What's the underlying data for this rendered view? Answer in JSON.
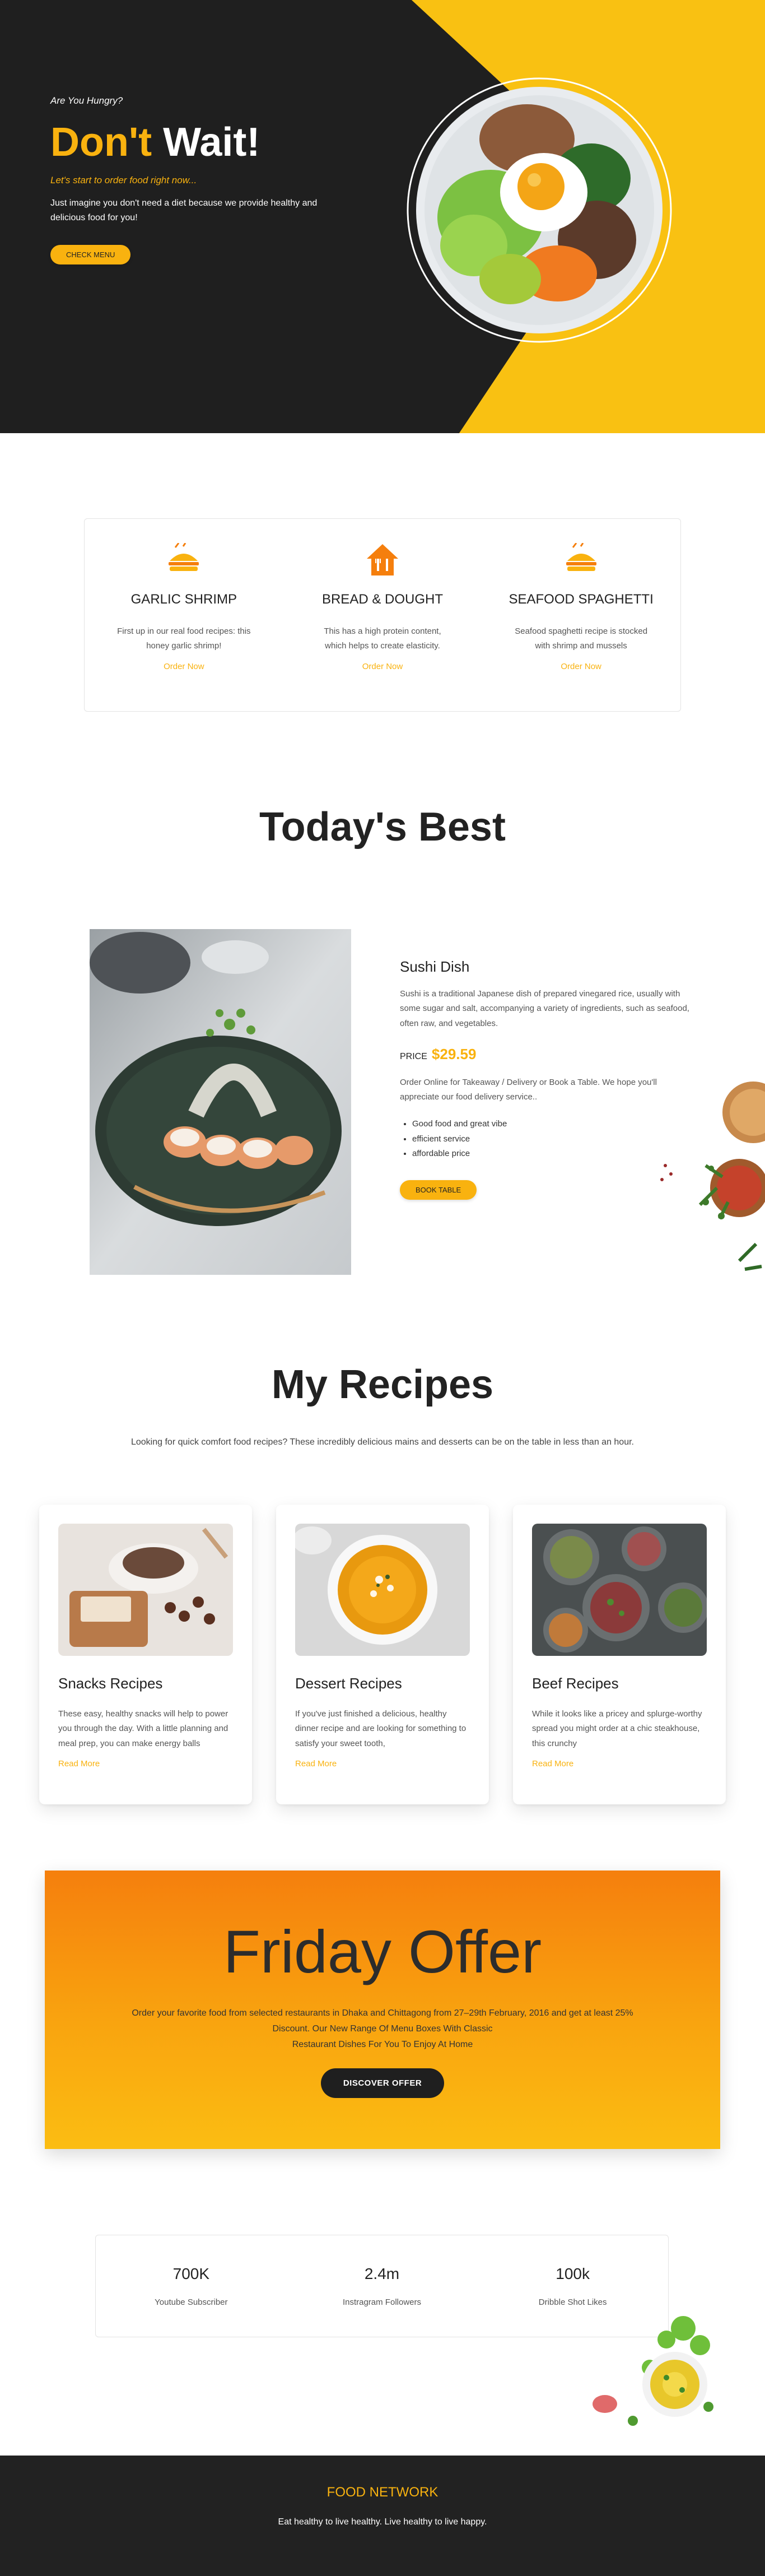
{
  "colors": {
    "accent": "#f9b20f",
    "dark": "#1f1f1f",
    "offer_top": "#f57f0d",
    "offer_bottom": "#fbbd12"
  },
  "hero": {
    "pretitle": "Are You Hungry?",
    "title_accent": "Don't",
    "title_rest": "Wait!",
    "subtitle": "Let's start to order food right now...",
    "description": "Just imagine you don't need a diet because we provide healthy and delicious food for you!",
    "button": "CHECK MENU"
  },
  "features": [
    {
      "icon": "burger-icon",
      "title": "GARLIC SHRIMP",
      "description": "First up in our real food recipes: this honey garlic shrimp!",
      "link": "Order Now"
    },
    {
      "icon": "house-cutlery-icon",
      "title": "BREAD & DOUGHT",
      "description": "This has a high protein content, which helps to create elasticity.",
      "link": "Order Now"
    },
    {
      "icon": "burger-icon",
      "title": "SEAFOOD SPAGHETTI",
      "description": "Seafood spaghetti recipe is stocked with shrimp and mussels",
      "link": "Order Now"
    }
  ],
  "best": {
    "section_title": "Today's Best",
    "name": "Sushi Dish",
    "description": "Sushi is a traditional Japanese dish of prepared vinegared rice, usually with some sugar and salt, accompanying a variety of ingredients, such as seafood, often raw, and vegetables.",
    "price_label": "PRICE",
    "price": "$29.59",
    "order_text": "Order Online for Takeaway / Delivery or Book a Table. We hope you'll appreciate our food delivery service..",
    "features": [
      "Good food and great vibe",
      "efficient service",
      "affordable price"
    ],
    "button": "BOOK TABLE"
  },
  "recipes": {
    "section_title": "My Recipes",
    "intro": "Looking for quick comfort food recipes? These incredibly delicious mains and desserts can be on the table in less than an hour.",
    "cards": [
      {
        "title": "Snacks Recipes",
        "description": "These easy, healthy snacks will help to power you through the day. With a little planning and meal prep, you can make energy balls",
        "link": "Read More"
      },
      {
        "title": "Dessert Recipes",
        "description": "If you've just finished a delicious, healthy dinner recipe and are looking for something to satisfy your sweet tooth,",
        "link": "Read More"
      },
      {
        "title": "Beef Recipes",
        "description": "While it looks like a pricey and splurge-worthy spread you might order at a chic steakhouse, this crunchy",
        "link": "Read More"
      }
    ]
  },
  "offer": {
    "title": "Friday Offer",
    "description_line1": "Order your favorite food from selected restaurants in Dhaka and Chittagong from 27–29th February, 2016 and get at least 25% Discount. Our New Range Of Menu Boxes With Classic",
    "description_line2": "Restaurant Dishes For You To Enjoy At Home",
    "button": "DISCOVER OFFER"
  },
  "stats": [
    {
      "value": "700K",
      "label": "Youtube Subscriber"
    },
    {
      "value": "2.4m",
      "label": "Instragram Followers"
    },
    {
      "value": "100k",
      "label": "Dribble Shot Likes"
    }
  ],
  "footer": {
    "brand": "FOOD NETWORK",
    "tagline": "Eat healthy to live healthy. Live healthy to live happy."
  }
}
